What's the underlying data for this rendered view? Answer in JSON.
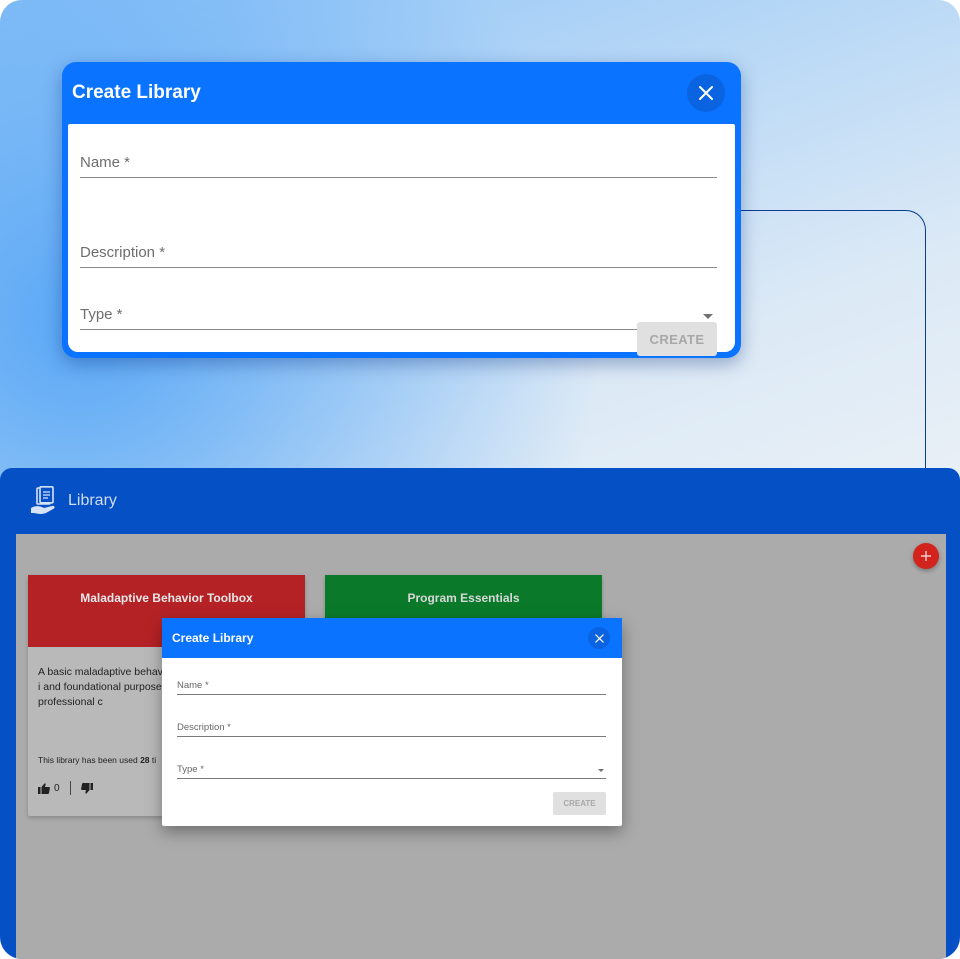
{
  "dialog": {
    "title": "Create Library",
    "fields": {
      "name": "Name *",
      "description": "Description *",
      "type": "Type *"
    },
    "create_label": "CREATE"
  },
  "app": {
    "title": "Library",
    "cards": [
      {
        "title": "Maladaptive Behavior Toolbox",
        "description": "A basic maladaptive behavi behaviors in this library are i and foundational purposes c as-is without professional c",
        "used_prefix": "This library has been used",
        "used_count": "28",
        "used_suffix": "ti",
        "likes": "0",
        "color": "#b52226"
      },
      {
        "title": "Program Essentials",
        "color": "#0a7a2a"
      }
    ]
  },
  "colors": {
    "primary": "#0a73ff",
    "appbar": "#0550c4",
    "fab": "#d2231c"
  }
}
